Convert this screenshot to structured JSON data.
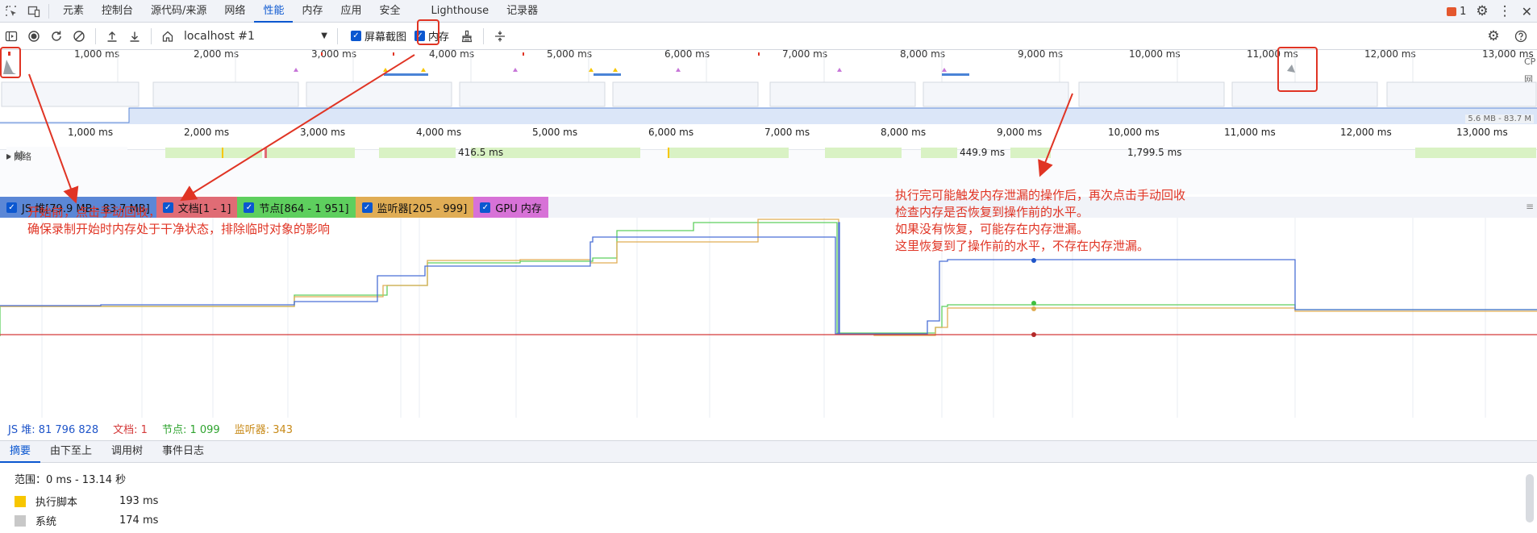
{
  "tabbar": {
    "tabs": [
      "元素",
      "控制台",
      "源代码/来源",
      "网络",
      "性能",
      "内存",
      "应用",
      "安全",
      "Lighthouse",
      "记录器"
    ],
    "active_index": 4,
    "issues_count": "1"
  },
  "toolbar": {
    "target": "localhost #1",
    "screenshots_label": "屏幕截图",
    "memory_label": "内存"
  },
  "ruler": {
    "labels": [
      "1,000 ms",
      "2,000 ms",
      "3,000 ms",
      "4,000 ms",
      "5,000 ms",
      "6,000 ms",
      "7,000 ms",
      "8,000 ms",
      "9,000 ms",
      "10,000 ms",
      "11,000 ms",
      "12,000 ms",
      "13,000 ms"
    ],
    "side_labels": [
      "CP",
      "网络"
    ],
    "heap_range": "5.6 MB - 83.7 M"
  },
  "tracks": {
    "network_label": "网络",
    "frames_label": "帧",
    "frame_times": [
      "416.5 ms",
      "449.9 ms",
      "1,799.5 ms"
    ]
  },
  "legend": [
    {
      "label": "JS 堆[79.9 MB - 83.7 MB]",
      "color": "#5b87d6"
    },
    {
      "label": "文档[1 - 1]",
      "color": "#e06c75"
    },
    {
      "label": "节点[864 - 1 951]",
      "color": "#5ecf5e"
    },
    {
      "label": "监听器[205 - 999]",
      "color": "#e0ad55"
    },
    {
      "label": "GPU 内存",
      "color": "#d772d7"
    }
  ],
  "counters": {
    "js_heap": "JS 堆: 81 796 828",
    "documents": "文档: 1",
    "nodes": "节点: 1 099",
    "listeners": "监听器: 343"
  },
  "bottom_tabs": [
    "摘要",
    "由下至上",
    "调用树",
    "事件日志"
  ],
  "summary": {
    "range": "范围：0 ms - 13.14 秒",
    "rows": [
      {
        "name": "执行脚本",
        "value": "193 ms",
        "color": "#f7c600"
      },
      {
        "name": "系统",
        "value": "174 ms",
        "color": "#c8c8c8"
      }
    ]
  },
  "annotations": {
    "left": [
      "开始前，点击手动回收，",
      "确保录制开始时内存处于干净状态，排除临时对象的影响"
    ],
    "right": [
      "执行完可能触发内存泄漏的操作后，再次点击手动回收",
      "检查内存是否恢复到操作前的水平。",
      "如果没有恢复，可能存在内存泄漏。",
      "这里恢复到了操作前的水平，不存在内存泄漏。"
    ]
  },
  "colors": {
    "accent": "#0b57d0",
    "annotation": "#e03424"
  }
}
